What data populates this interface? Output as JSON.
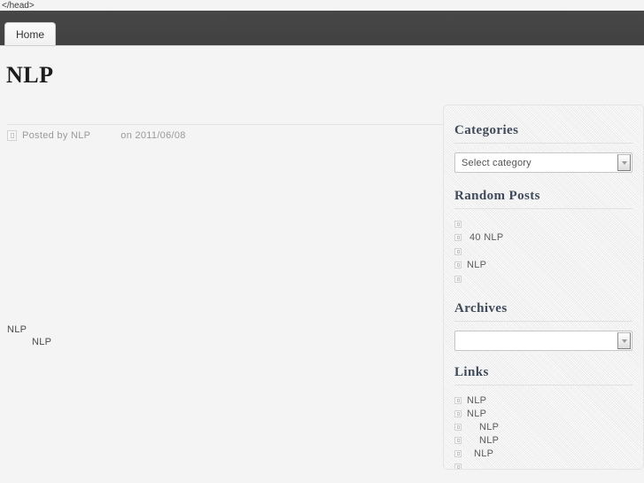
{
  "stray_markup": "</head>",
  "navbar": {
    "tabs": [
      {
        "label": "Home"
      }
    ]
  },
  "page": {
    "title": "NLP"
  },
  "post": {
    "meta": {
      "icon": "broken-image-icon",
      "author": "Posted by NLP",
      "date": "on 2011/06/08"
    },
    "body_lines": [
      "NLP",
      "NLP"
    ]
  },
  "sidebar": {
    "categories": {
      "title": "Categories",
      "select": {
        "value": "Select category",
        "icon": "chevron-down-icon"
      }
    },
    "random_posts": {
      "title": "Random Posts",
      "items": [
        {
          "label": ""
        },
        {
          "label": "40 NLP"
        },
        {
          "label": ""
        },
        {
          "label": "NLP"
        },
        {
          "label": ""
        }
      ]
    },
    "archives": {
      "title": "Archives",
      "select": {
        "value": "",
        "icon": "chevron-down-icon"
      }
    },
    "links": {
      "title": "Links",
      "items": [
        {
          "label": "NLP"
        },
        {
          "label": "NLP"
        },
        {
          "label": "NLP"
        },
        {
          "label": "NLP"
        },
        {
          "label": "NLP"
        },
        {
          "label": ""
        }
      ]
    }
  },
  "colors": {
    "navbar": "#434343",
    "page_background": "#f4f4f4",
    "widget_title": "#3f4a5a",
    "muted_text": "#9a9a9a"
  }
}
